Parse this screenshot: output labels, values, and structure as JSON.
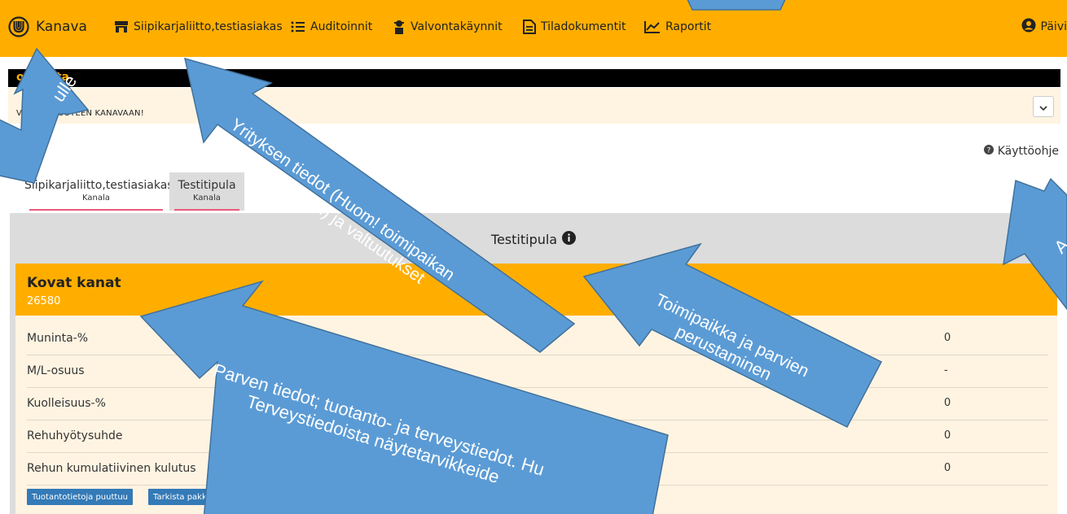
{
  "navbar": {
    "brand": "Kanava",
    "items": [
      {
        "label": "Siipikarjaliitto,testiasiakas",
        "icon": "store-icon"
      },
      {
        "label": "Auditoinnit",
        "icon": "list-icon"
      },
      {
        "label": "Valvontakäynnit",
        "icon": "inspector-icon"
      },
      {
        "label": "Tiladokumentit",
        "icon": "document-icon"
      },
      {
        "label": "Raportit",
        "icon": "line-chart-icon"
      }
    ],
    "user": "Päivi",
    "bg_color": "#FFAE00"
  },
  "announcement": {
    "title": "ohtaista",
    "text": "VETULOA UUTEEN KANAVAAN!"
  },
  "help_link": "Käyttöohje",
  "tabs": [
    {
      "label": "Siipikarjaliitto,testiasiakas",
      "sub": "Kanala"
    },
    {
      "label": "Testitipula",
      "sub": "Kanala"
    }
  ],
  "panel": {
    "title": "Testitipula"
  },
  "flock": {
    "name": "Kovat kanat",
    "id": "26580",
    "stats": [
      {
        "label": "Muninta-%",
        "value": "0"
      },
      {
        "label": "M/L-osuus",
        "value": "-"
      },
      {
        "label": "Kuolleisuus-%",
        "value": "0"
      },
      {
        "label": "Rehuhyötysuhde",
        "value": "0"
      },
      {
        "label": "Rehun kumulatiivinen kulutus",
        "value": "0"
      }
    ],
    "buttons": [
      "Tuotantotietoja puuttuu",
      "Tarkista pakkaamotunniste"
    ]
  },
  "annotations": {
    "a1": "ulle",
    "a2": "Yrityksen tiedot (Huom! toimipaikan\nperustaminen) ja valtuutukset",
    "a3": "Toimipaikka ja parvien\nperustaminen",
    "a4": "Parven tiedot; tuotanto- ja terveystiedot. Hu\nTerveystiedoista näytetarvikkeide",
    "a5": "A",
    "arrow_color": "#5B9BD5"
  }
}
